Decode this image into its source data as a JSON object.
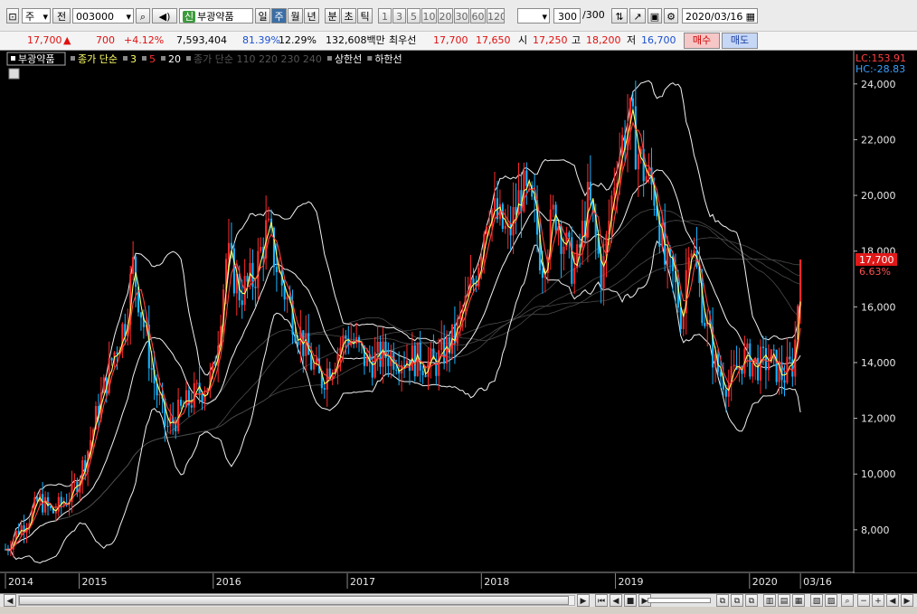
{
  "toolbar": {
    "period_select": "주",
    "prev_button": "전",
    "stock_code": "003000",
    "stock_badge": "신",
    "stock_name": "부광약품",
    "tabs": [
      "일",
      "주",
      "월",
      "년",
      "분",
      "초",
      "틱"
    ],
    "active_tab": "주",
    "minute_buttons": [
      "1",
      "3",
      "5",
      "10",
      "20",
      "30",
      "60",
      "120"
    ],
    "bar_count": "300",
    "bar_count_total": "/300",
    "date": "2020/03/16"
  },
  "quote": {
    "price": "17,700",
    "arrow": "▲",
    "change": "700",
    "change_pct": "+4.12%",
    "volume": "7,593,404",
    "vol_ratio": "81.39%",
    "turnover": "12.29%",
    "amount": "132,608백만",
    "best_label": "최우선",
    "ask": "17,700",
    "bid": "17,650",
    "open_label": "시",
    "open": "17,250",
    "high_label": "고",
    "high": "18,200",
    "low_label": "저",
    "low": "16,700",
    "buy_button": "매수",
    "sell_button": "매도"
  },
  "chart_data": {
    "type": "candlestick",
    "title_tag": "부광약품",
    "legend": [
      {
        "name": "종가 단순",
        "color": "#ffff66"
      },
      {
        "name": "3",
        "color": "#ffff66"
      },
      {
        "name": "5",
        "color": "#ff3030"
      },
      {
        "name": "20",
        "color": "#ffffff"
      },
      {
        "name": "종가 단순 110 220 230 240",
        "color": "#555555"
      },
      {
        "name": "상한선",
        "color": "#ffffff"
      },
      {
        "name": "하한선",
        "color": "#ffffff"
      }
    ],
    "corner": {
      "lc": "LC:153.91",
      "hc": "HC:-28.83"
    },
    "current": {
      "price": "17,700",
      "pct": "6.63%",
      "value": 17700
    },
    "ylim": [
      6600,
      25000
    ],
    "ytick_labels": [
      "24,000",
      "22,000",
      "20,000",
      "18,000",
      "16,000",
      "14,000",
      "12,000",
      "10,000",
      "8,000"
    ],
    "ytick_values": [
      24000,
      22000,
      20000,
      18000,
      16000,
      14000,
      12000,
      10000,
      8000
    ],
    "xlim": [
      2014.0,
      2020.3
    ],
    "xtick_labels": [
      "2014",
      "2015",
      "2016",
      "2017",
      "2018",
      "2019",
      "2020",
      "03/16"
    ],
    "xtick_values": [
      2014.0,
      2014.55,
      2015.55,
      2016.55,
      2017.55,
      2018.55,
      2019.55,
      2019.93
    ],
    "closes": [
      [
        2014.0,
        7300
      ],
      [
        2014.1,
        8000
      ],
      [
        2014.2,
        8600
      ],
      [
        2014.25,
        9100
      ],
      [
        2014.35,
        8600
      ],
      [
        2014.5,
        9300
      ],
      [
        2014.6,
        10600
      ],
      [
        2014.7,
        12500
      ],
      [
        2014.8,
        14200
      ],
      [
        2014.9,
        15600
      ],
      [
        2014.95,
        17500
      ],
      [
        2015.0,
        16200
      ],
      [
        2015.1,
        13500
      ],
      [
        2015.2,
        11600
      ],
      [
        2015.35,
        12500
      ],
      [
        2015.45,
        13000
      ],
      [
        2015.55,
        13500
      ],
      [
        2015.65,
        17900
      ],
      [
        2015.75,
        16500
      ],
      [
        2015.85,
        17000
      ],
      [
        2015.95,
        18800
      ],
      [
        2016.05,
        17000
      ],
      [
        2016.15,
        15600
      ],
      [
        2016.25,
        14300
      ],
      [
        2016.35,
        13300
      ],
      [
        2016.45,
        14200
      ],
      [
        2016.55,
        15000
      ],
      [
        2016.7,
        14000
      ],
      [
        2016.85,
        14300
      ],
      [
        2017.0,
        14200
      ],
      [
        2017.2,
        13900
      ],
      [
        2017.35,
        14900
      ],
      [
        2017.5,
        17000
      ],
      [
        2017.6,
        19700
      ],
      [
        2017.75,
        18500
      ],
      [
        2017.85,
        20200
      ],
      [
        2017.95,
        19200
      ],
      [
        2018.0,
        17500
      ],
      [
        2018.1,
        19500
      ],
      [
        2018.2,
        17800
      ],
      [
        2018.25,
        17200
      ],
      [
        2018.35,
        19900
      ],
      [
        2018.45,
        17000
      ],
      [
        2018.55,
        21000
      ],
      [
        2018.65,
        22800
      ],
      [
        2018.75,
        21000
      ],
      [
        2018.85,
        20000
      ],
      [
        2018.92,
        17500
      ],
      [
        2018.98,
        17000
      ],
      [
        2019.05,
        15500
      ],
      [
        2019.1,
        18800
      ],
      [
        2019.2,
        16000
      ],
      [
        2019.3,
        13800
      ],
      [
        2019.4,
        13200
      ],
      [
        2019.5,
        14200
      ],
      [
        2019.6,
        13900
      ],
      [
        2019.7,
        14100
      ],
      [
        2019.8,
        13500
      ],
      [
        2019.88,
        14000
      ],
      [
        2019.93,
        17700
      ]
    ]
  },
  "scroll": {
    "first": "⏮",
    "prev": "◀",
    "stop": "■",
    "next": "▶",
    "zoom_out": "−",
    "zoom_in": "+"
  }
}
